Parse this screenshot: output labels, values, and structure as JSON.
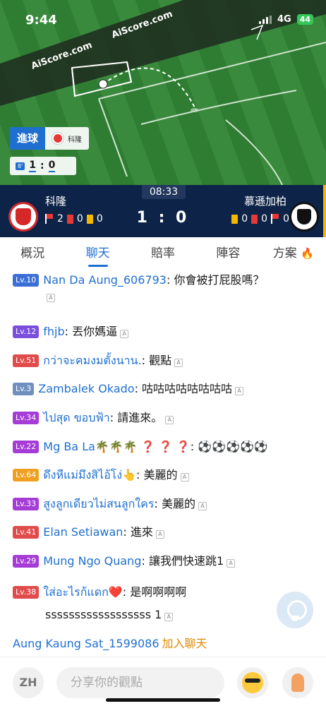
{
  "status_bar": {
    "time": "9:44",
    "network": "4G",
    "battery": "44"
  },
  "pitch": {
    "watermark_1": "AiScore.com",
    "watermark_2": "AiScore.com",
    "event_label": "進球",
    "event_team": "科隆",
    "mini_score": {
      "minute": "8'",
      "home": "1",
      "sep": ":",
      "away": "0"
    }
  },
  "scoreboard": {
    "clock": "08:33",
    "home": {
      "name": "科隆",
      "corners": "2",
      "red_cards": "0",
      "yellow_cards": "0"
    },
    "away": {
      "name": "慕遜加柏",
      "yellow_cards": "0",
      "red_cards": "0",
      "corners": "0"
    },
    "score": "1 : 0"
  },
  "tabs": [
    {
      "label": "概況"
    },
    {
      "label": "聊天"
    },
    {
      "label": "賠率"
    },
    {
      "label": "陣容"
    },
    {
      "label": "方案"
    }
  ],
  "active_tab": "聊天",
  "chat": {
    "report_glyph": "A",
    "messages": [
      {
        "level": "Lv.10",
        "level_color": "#3b6fd6",
        "user": "Nan Da Aung_606793",
        "text": "你會被打屁股嗎？"
      },
      {
        "level": "Lv.12",
        "level_color": "#7a4fdc",
        "user": "fhjb",
        "text": "丟你媽逼"
      },
      {
        "level": "Lv.51",
        "level_color": "#e14b4b",
        "user": "กว่าจะคมงมตั้งนาน.",
        "text": "觀點"
      },
      {
        "level": "Lv.3",
        "level_color": "#6f8fbf",
        "user": "Zambalek Okado",
        "text": "咕咕咕咕咕咕咕咕"
      },
      {
        "level": "Lv.34",
        "level_color": "#a53cd6",
        "user": "ไปสุด ขอบฟ้า",
        "text": "請進來。"
      },
      {
        "level": "Lv.22",
        "level_color": "#a53cd6",
        "user": "Mg Ba La🌴🌴🌴 ❓ ❓ ❓",
        "text": "⚽⚽⚽⚽⚽"
      },
      {
        "level": "Lv.64",
        "level_color": "#f0a020",
        "user": "ดึงหีแม่มึงสิไอ้โง่👆",
        "text": "美麗的"
      },
      {
        "level": "Lv.33",
        "level_color": "#a53cd6",
        "user": "สูงลูกเดียวไม่สนลูกใคร",
        "text": "美麗的"
      },
      {
        "level": "Lv.41",
        "level_color": "#e14b4b",
        "user": "Elan Setiawan",
        "text": "進來"
      },
      {
        "level": "Lv.29",
        "level_color": "#a53cd6",
        "user": "Mung Ngo Quang",
        "text": "讓我們快速跳1"
      },
      {
        "level": "Lv.38",
        "level_color": "#e14b4b",
        "user": "ใส่อะไรก้แดก❤️",
        "text": "是啊啊啊啊",
        "text_line2": "ssssssssssssssssss 1"
      }
    ],
    "join": {
      "user": "Aung Kaung Sat_1599086",
      "action": "加入聊天"
    }
  },
  "input_bar": {
    "lang_button": "ZH",
    "placeholder": "分享你的觀點"
  }
}
